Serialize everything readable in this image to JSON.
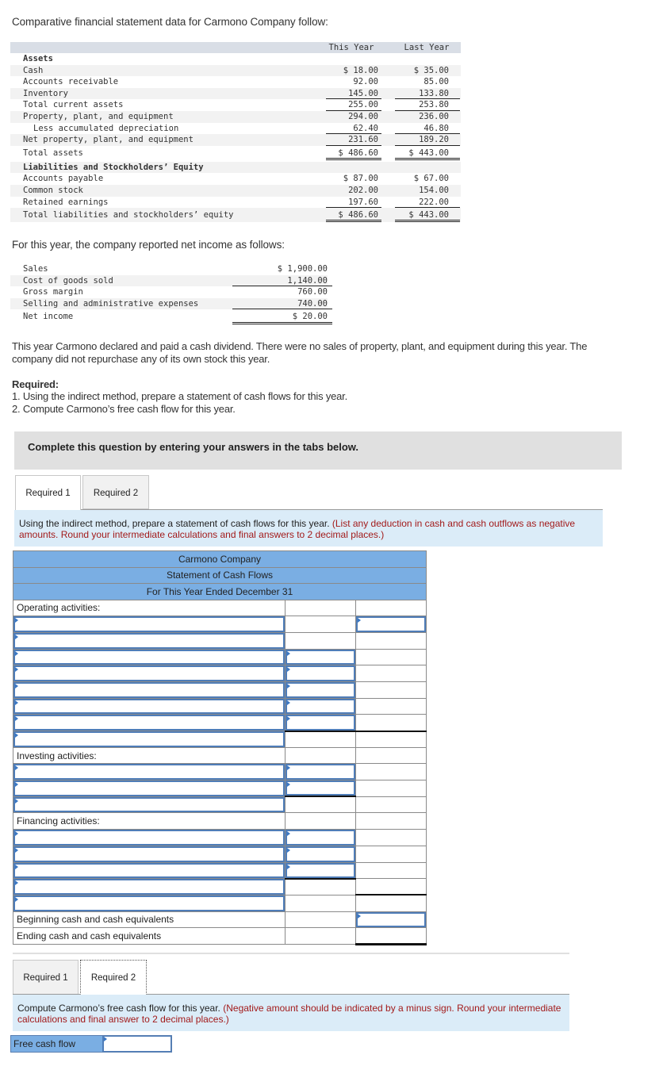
{
  "intro": "Comparative financial statement data for Carmono Company follow:",
  "balance_sheet": {
    "headers": [
      "This Year",
      "Last Year"
    ],
    "sections": {
      "assets_title": "Assets",
      "liab_title": "Liabilities and Stockholders’ Equity"
    },
    "rows": [
      {
        "label": "Cash",
        "this": "$ 18.00",
        "last": "$ 35.00"
      },
      {
        "label": "Accounts receivable",
        "this": "92.00",
        "last": "85.00"
      },
      {
        "label": "Inventory",
        "this": "145.00",
        "last": "133.80"
      },
      {
        "label": "Total current assets",
        "this": "255.00",
        "last": "253.80"
      },
      {
        "label": "Property, plant, and equipment",
        "this": "294.00",
        "last": "236.00"
      },
      {
        "label": "Less accumulated depreciation",
        "this": "62.40",
        "last": "46.80"
      },
      {
        "label": "Net property, plant, and equipment",
        "this": "231.60",
        "last": "189.20"
      },
      {
        "label": "Total assets",
        "this": "$ 486.60",
        "last": "$ 443.00"
      },
      {
        "label": "Accounts payable",
        "this": "$ 87.00",
        "last": "$ 67.00"
      },
      {
        "label": "Common stock",
        "this": "202.00",
        "last": "154.00"
      },
      {
        "label": "Retained earnings",
        "this": "197.60",
        "last": "222.00"
      },
      {
        "label": "Total liabilities and stockholders’ equity",
        "this": "$ 486.60",
        "last": "$ 443.00"
      }
    ]
  },
  "income_intro": "For this year, the company reported net income as follows:",
  "income": [
    {
      "label": "Sales",
      "value": "$ 1,900.00"
    },
    {
      "label": "Cost of goods sold",
      "value": "1,140.00"
    },
    {
      "label": "Gross margin",
      "value": "760.00"
    },
    {
      "label": "Selling and administrative expenses",
      "value": "740.00"
    },
    {
      "label": "Net income",
      "value": "$ 20.00"
    }
  ],
  "note_line1": "This year Carmono declared and paid a cash dividend. There were no sales of property, plant, and equipment during this year. The",
  "note_line2": "company did not repurchase any of its own stock this year.",
  "required": {
    "title": "Required:",
    "items": [
      "1. Using the indirect method, prepare a statement of cash flows for this year.",
      "2. Compute Carmono’s free cash flow for this year."
    ]
  },
  "complete_banner": "Complete this question by entering your answers in the tabs below.",
  "tabs": [
    "Required 1",
    "Required 2"
  ],
  "req1": {
    "instruction": "Using the indirect method, prepare a statement of cash flows for this year.",
    "instruction_red": "(List any deduction in cash and cash outflows as negative amounts. Round your intermediate calculations and final answers to 2 decimal places.)",
    "table_title": [
      "Carmono Company",
      "Statement of Cash Flows",
      "For This Year Ended December 31"
    ],
    "operating_label": "Operating activities:",
    "investing_label": "Investing activities:",
    "financing_label": "Financing activities:",
    "beginning_label": "Beginning cash and cash equivalents",
    "ending_label": "Ending cash and cash equivalents"
  },
  "req2": {
    "instruction": "Compute Carmono’s free cash flow for this year.",
    "instruction_red": "(Negative amount should be indicated by a minus sign. Round your intermediate calculations and final answer to 2 decimal places.)",
    "fcf_label": "Free cash flow",
    "fcf_value": ""
  }
}
